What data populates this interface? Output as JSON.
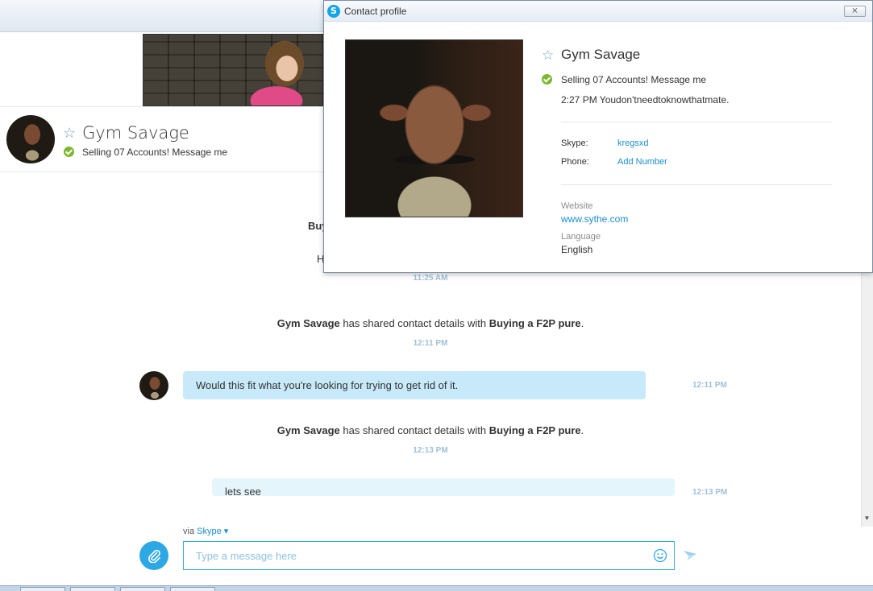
{
  "contact": {
    "name": "Gym Savage",
    "mood": "Selling 07 Accounts! Message me"
  },
  "chat": {
    "partial_bold": "Buy",
    "partial_text": "H",
    "timestamps": [
      "11:25 AM",
      "12:11 PM",
      "12:13 PM"
    ],
    "system_messages": [
      {
        "sender": "Gym Savage",
        "text": " has shared contact details with ",
        "target": "Buying a F2P pure",
        "end": "."
      },
      {
        "sender": "Gym Savage",
        "text": " has shared contact details with ",
        "target": "Buying a F2P pure",
        "end": "."
      }
    ],
    "messages": [
      {
        "text": "Would this fit what you're looking for trying to get rid of it.",
        "time": "12:11 PM",
        "direction": "in"
      },
      {
        "text": "lets see",
        "time": "12:13 PM",
        "direction": "out"
      }
    ]
  },
  "compose": {
    "via_label": "via",
    "via_service": "Skype",
    "placeholder": "Type a message here"
  },
  "popup": {
    "title": "Contact profile",
    "close_label": "⨯",
    "last_message": "2:27 PM Youdon'tneedtoknowthatmate.",
    "skype_label": "Skype:",
    "skype_value": "kregsxd",
    "phone_label": "Phone:",
    "phone_value": "Add Number",
    "website_label": "Website",
    "website_value": "www.sythe.com",
    "language_label": "Language",
    "language_value": "English"
  },
  "icons": {
    "star": "star-icon",
    "status": "online-status-icon",
    "attach": "paperclip-icon",
    "emoji": "emoji-icon",
    "send": "send-icon",
    "close": "close-icon",
    "logo": "skype-logo-icon"
  },
  "colors": {
    "accent": "#2ea8e5",
    "link": "#1a8fd1",
    "online": "#7cb82f",
    "bubble_in": "#c7e9f9",
    "bubble_out": "#e5f5fc",
    "timestamp": "#9fc1da"
  }
}
